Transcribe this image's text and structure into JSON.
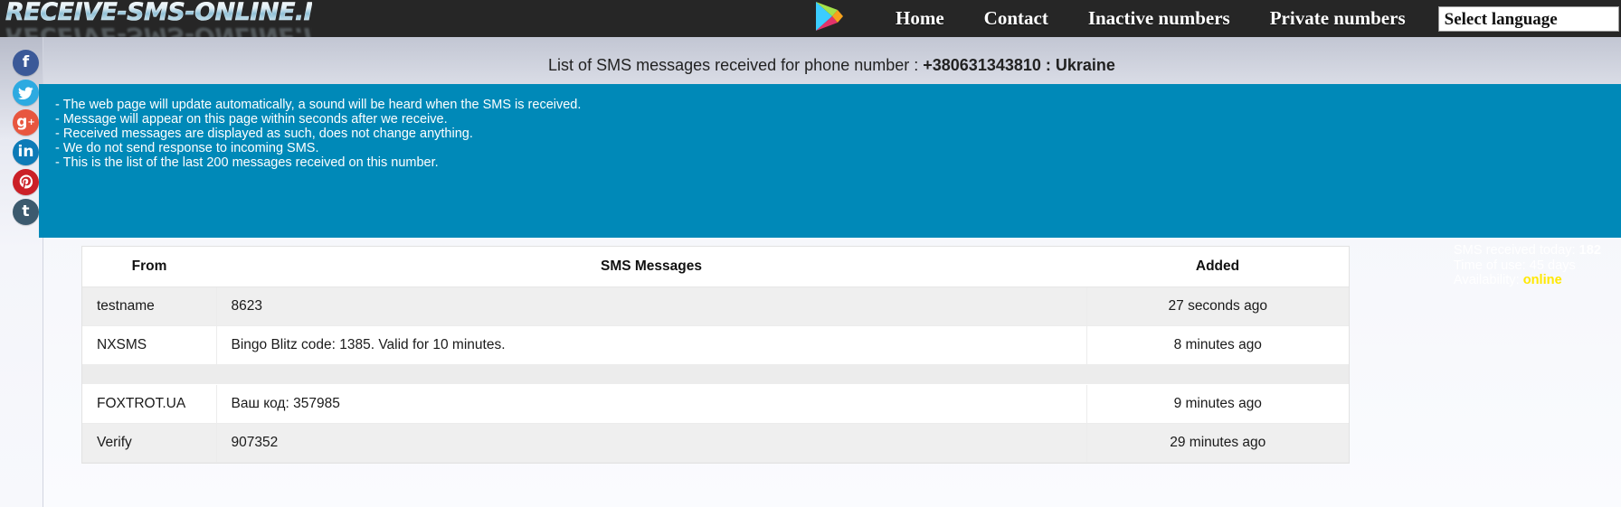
{
  "site": {
    "logo_text": "RECEIVE-SMS-ONLINE.INFO"
  },
  "nav": {
    "play_icon": "google-play-icon",
    "items": [
      {
        "label": "Home"
      },
      {
        "label": "Contact"
      },
      {
        "label": "Inactive numbers"
      },
      {
        "label": "Private numbers"
      }
    ],
    "language_selector": "Select language"
  },
  "social": {
    "items": [
      {
        "name": "facebook",
        "glyph": "f"
      },
      {
        "name": "twitter",
        "glyph": "ᴠ"
      },
      {
        "name": "googleplus",
        "glyph": "g+"
      },
      {
        "name": "linkedin",
        "glyph": "in"
      },
      {
        "name": "pinterest",
        "glyph": "Ⓟ"
      },
      {
        "name": "tumblr",
        "glyph": "t"
      }
    ]
  },
  "page": {
    "title_prefix": "List of SMS messages received for phone number : ",
    "phone_number": "+380631343810",
    "country_sep": " : ",
    "country": "Ukraine"
  },
  "info": {
    "lines": [
      "- The web page will update automatically, a sound will be heard when the SMS is received.",
      "- Message will appear on this page within seconds after we receive.",
      "- Received messages are displayed as such, does not change anything.",
      "- We do not send response to incoming SMS.",
      "- This is the list of the last 200 messages received on this number."
    ],
    "speaker_icon": "speaker-sound-icon",
    "stats": {
      "sms_today_label": "SMS received today: ",
      "sms_today_value": "182",
      "time_of_use_label": "Time of use: ",
      "time_of_use_value": "45 days",
      "availability_label": "Availability: ",
      "availability_value": "online"
    },
    "bg_color": "#0089b8",
    "online_color": "#ffe800"
  },
  "table": {
    "headers": {
      "from": "From",
      "messages": "SMS Messages",
      "added": "Added"
    },
    "rows": [
      {
        "from": "testname",
        "message": "8623",
        "added": "27 seconds ago",
        "alt": true
      },
      {
        "from": "NXSMS",
        "message": "Bingo Blitz code: 1385. Valid for 10 minutes.",
        "added": "8 minutes ago",
        "alt": false
      },
      {
        "from": "",
        "message": "",
        "added": "",
        "spacer": true
      },
      {
        "from": "FOXTROT.UA",
        "message": "Ваш код: 357985",
        "added": "9 minutes ago",
        "alt": false
      },
      {
        "from": "Verify",
        "message": "907352",
        "added": "29 minutes ago",
        "alt": true
      }
    ]
  }
}
